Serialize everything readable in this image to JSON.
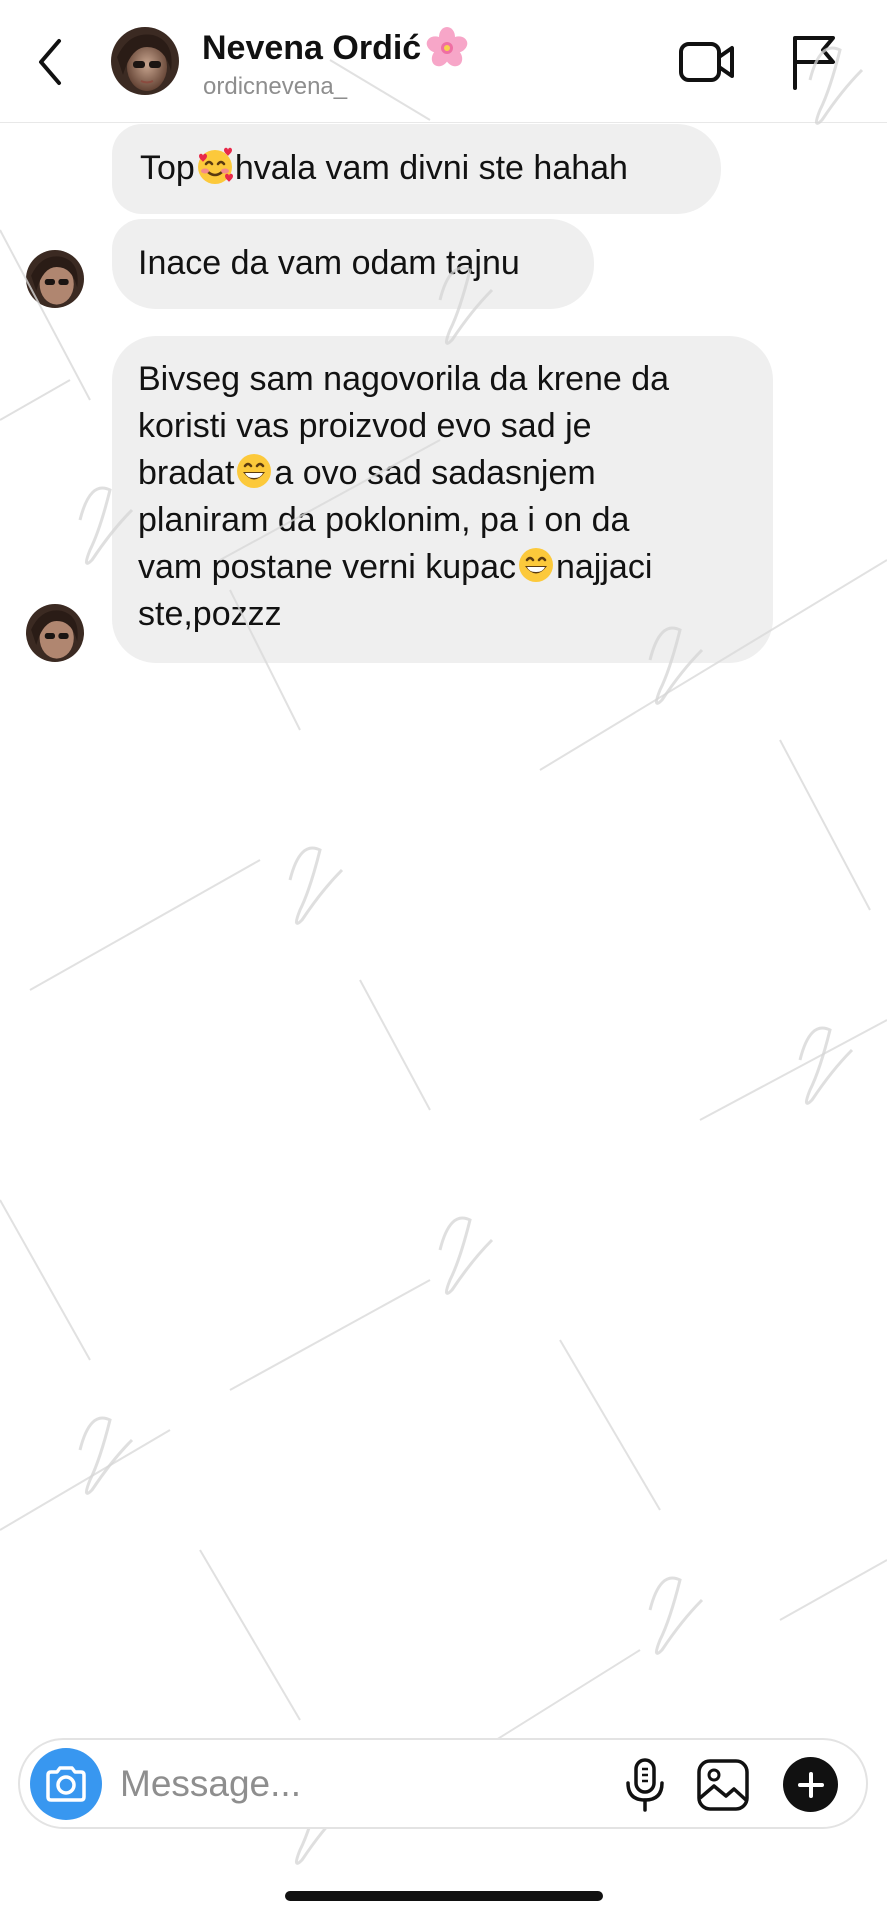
{
  "header": {
    "contact_name": "Nevena Ordić",
    "name_emoji": "cherry-blossom-emoji",
    "username": "ordicnevena_",
    "back_icon": "chevron-left-icon",
    "video_icon": "video-camera-icon",
    "flag_icon": "flag-icon"
  },
  "messages": [
    {
      "parts": [
        "Top",
        "hvala vam divni ste hahah"
      ],
      "emoji": "smiling-face-with-hearts-emoji"
    },
    {
      "text": "Inace da vam odam tajnu"
    },
    {
      "lines": [
        "Bivseg sam nagovorila da krene da",
        "koristi vas proizvod evo sad je",
        "bradat",
        "a ovo sad sadasnjem",
        "planiram da poklonim, pa i on da",
        "vam postane verni kupac",
        "najjaci",
        "ste,pozzz"
      ],
      "emoji": "grinning-face-with-smiling-eyes-emoji"
    }
  ],
  "composer": {
    "placeholder": "Message...",
    "value": "",
    "camera_icon": "camera-icon",
    "mic_icon": "microphone-icon",
    "gallery_icon": "gallery-icon",
    "plus_icon": "plus-icon"
  },
  "colors": {
    "bubble_bg": "#efefef",
    "camera_blue": "#3897f0",
    "text": "#121212",
    "secondary_text": "#8e8e8e"
  }
}
